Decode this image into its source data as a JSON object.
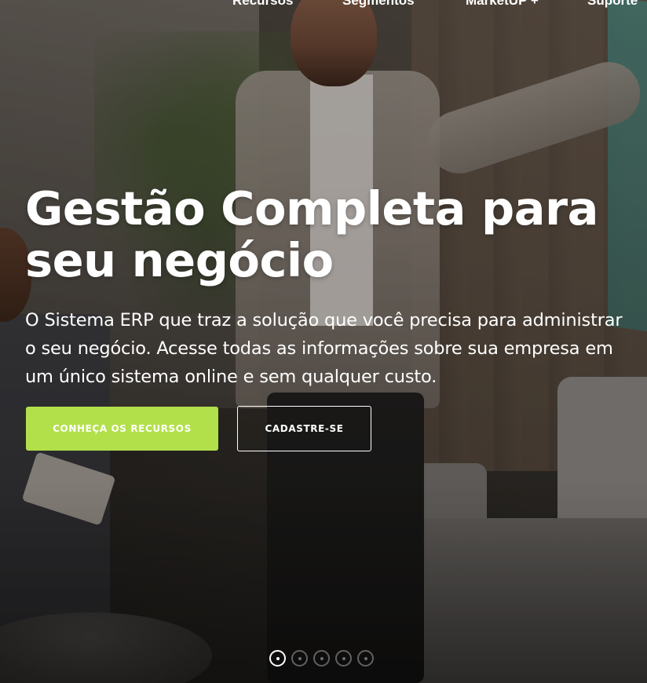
{
  "nav": {
    "items": [
      {
        "label": "Recursos"
      },
      {
        "label": "Segmentos"
      },
      {
        "label": "MarketUP +"
      },
      {
        "label": "Suporte"
      }
    ]
  },
  "hero": {
    "title_line1": "Gestão Completa para",
    "title_line2": "seu negócio",
    "subtitle": "O Sistema ERP que traz a solução que você precisa para administrar o seu negócio. Acesse todas as informações sobre sua empresa em um único sistema online e sem qualquer custo.",
    "primary_button": "CONHEÇA OS RECURSOS",
    "secondary_button": "CADASTRE-SE"
  },
  "carousel": {
    "slide_count": 5,
    "active_index": 0
  },
  "colors": {
    "accent": "#b2e04a",
    "text": "#ffffff"
  }
}
